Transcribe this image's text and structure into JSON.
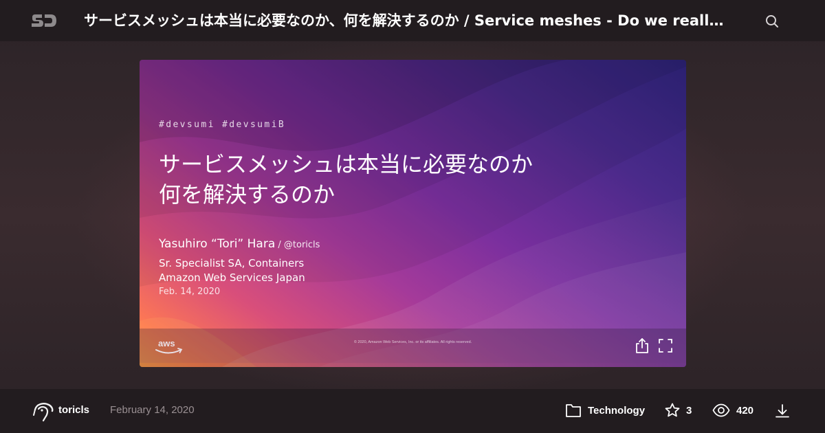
{
  "header": {
    "title": "サービスメッシュは本当に必要なのか、何を解決するのか / Service meshes - Do we really need them? What problems do they solve?",
    "logo_icon": "speakerdeck-logo-icon",
    "search_icon": "search-icon"
  },
  "slide": {
    "hashtags": "#devsumi #devsumiB",
    "title_line1": "サービスメッシュは本当に必要なのか",
    "title_line2": "何を解決するのか",
    "presenter_name": "Yasuhiro “Tori” Hara",
    "presenter_handle": " / @toricls",
    "role_line1": "Sr. Specialist SA, Containers",
    "role_line2": "Amazon Web Services Japan",
    "date": "Feb. 14, 2020",
    "copyright": "© 2020, Amazon Web Services, Inc. or its affiliates. All rights reserved.",
    "logo_text": "aws",
    "progress": 0.0
  },
  "footer": {
    "username": "toricls",
    "published": "February 14, 2020",
    "category": "Technology",
    "stars": "3",
    "views": "420"
  },
  "colors": {
    "header_bg": "#221c1f",
    "accent_orange": "#ff7a52",
    "accent_purple": "#4a2a8a"
  }
}
